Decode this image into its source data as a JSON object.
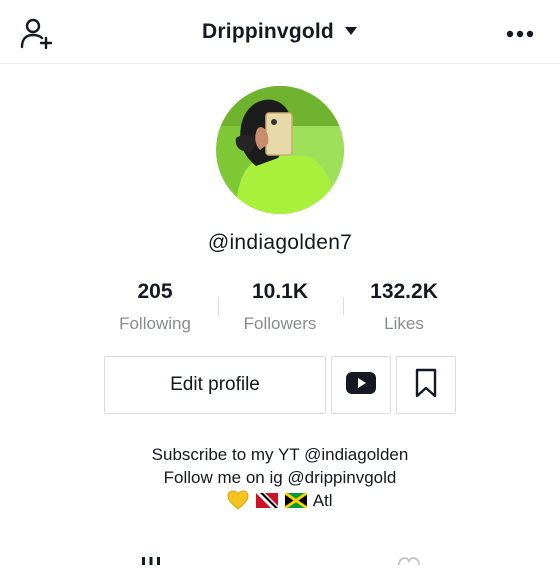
{
  "header": {
    "account_name": "Drippinvgold",
    "icons": {
      "left": "add-user-icon",
      "caret": "caret-down-icon",
      "right": "more-dots-icon"
    }
  },
  "profile": {
    "avatar": "profile-photo",
    "username": "@indiagolden7"
  },
  "stats": [
    {
      "value": "205",
      "label": "Following"
    },
    {
      "value": "10.1K",
      "label": "Followers"
    },
    {
      "value": "132.2K",
      "label": "Likes"
    }
  ],
  "actions": {
    "edit_profile_label": "Edit profile",
    "youtube_icon": "youtube-icon",
    "bookmark_icon": "bookmark-icon"
  },
  "bio": {
    "line1": "Subscribe to my YT @indiagolden",
    "line2": "Follow me on ig @drippinvgold",
    "line3_text": "Atl",
    "line3_emoji": [
      "yellow-heart",
      "trinidad-flag",
      "jamaica-flag"
    ]
  },
  "tabs": {
    "icons": [
      "grid-icon",
      "heart-icon"
    ]
  },
  "colors": {
    "text": "#161823",
    "muted": "#8a8b91",
    "border": "#dcdcdc",
    "avatar_bg": "#8fe03a"
  }
}
